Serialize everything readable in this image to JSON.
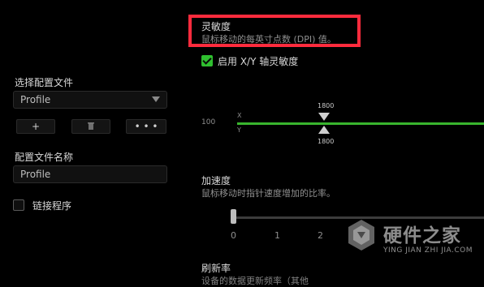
{
  "left_panel": {
    "select_profile_label": "选择配置文件",
    "profile_select_value": "Profile",
    "profile_name_label": "配置文件名称",
    "profile_name_value": "Profile",
    "link_program_label": "链接程序",
    "buttons": {
      "add": "+",
      "more": "• • •"
    }
  },
  "sensitivity": {
    "title": "灵敏度",
    "desc": "鼠标移动的每英寸点数 (DPI) 值。",
    "enable_xy_label": "启用 X/Y 轴灵敏度",
    "min_label": "100",
    "axis_x": "X",
    "axis_y": "Y",
    "x_value": "1800",
    "y_value": "1800"
  },
  "acceleration": {
    "title": "加速度",
    "desc": "鼠标移动时指针速度增加的比率。",
    "ticks": [
      "0",
      "1",
      "2"
    ]
  },
  "polling": {
    "title": "刷新率",
    "desc_partial": "设备的数据更新频率（其他"
  },
  "watermark": {
    "cn": "硬件之家",
    "pinyin": "YING JIAN ZHI JIA.COM"
  },
  "colors": {
    "accent_green": "#39b52e",
    "highlight_red": "#ff2b3d"
  }
}
